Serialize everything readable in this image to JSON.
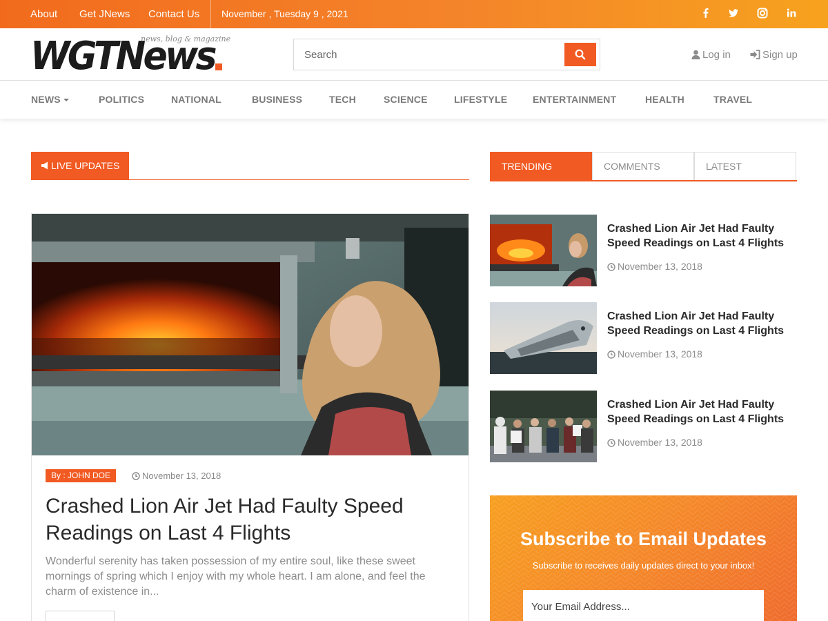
{
  "topbar": {
    "links": [
      "About",
      "Get JNews",
      "Contact Us"
    ],
    "date": "November , Tuesday 9 , 2021",
    "social_icons": [
      "facebook-icon",
      "twitter-icon",
      "instagram-icon",
      "linkedin-icon"
    ]
  },
  "header": {
    "logo_text": "WGTNews",
    "logo_tagline": "news, blog & magazine",
    "search_placeholder": "Search",
    "login_label": "Log in",
    "signup_label": "Sign up"
  },
  "nav": {
    "items": [
      "NEWS",
      "POLITICS",
      "NATIONAL",
      "BUSINESS",
      "TECH",
      "SCIENCE",
      "LIFESTYLE",
      "ENTERTAINMENT",
      "HEALTH",
      "TRAVEL"
    ]
  },
  "live": {
    "label": "LIVE UPDATES"
  },
  "feature": {
    "author": "By : JOHN DOE",
    "date": "November 13, 2018",
    "title": "Crashed Lion Air Jet Had Faulty Speed Readings on Last 4 Flights",
    "excerpt": "Wonderful serenity has taken possession of my entire soul, like these sweet mornings of spring which I enjoy with my whole heart. I am alone, and feel the charm of existence in..."
  },
  "sidebar": {
    "tabs": [
      "TRENDING",
      "COMMENTS",
      "LATEST"
    ],
    "active_tab": "TRENDING",
    "trending": [
      {
        "title": "Crashed Lion Air Jet Had Faulty Speed Readings on Last 4 Flights",
        "date": "November 13, 2018"
      },
      {
        "title": "Crashed Lion Air Jet Had Faulty Speed Readings on Last 4 Flights",
        "date": "November 13, 2018"
      },
      {
        "title": "Crashed Lion Air Jet Had Faulty Speed Readings on Last 4 Flights",
        "date": "November 13, 2018"
      }
    ]
  },
  "subscribe": {
    "title": "Subscribe to Email Updates",
    "subtitle": "Subscribe to receives daily updates direct to your inbox!",
    "email_placeholder": "Your Email Address..."
  },
  "colors": {
    "accent": "#f15a22",
    "topbar_start": "#f26b1d",
    "topbar_end": "#f7a21e",
    "text_dark": "#2a2a2a",
    "text_muted": "#8c8c8c"
  }
}
